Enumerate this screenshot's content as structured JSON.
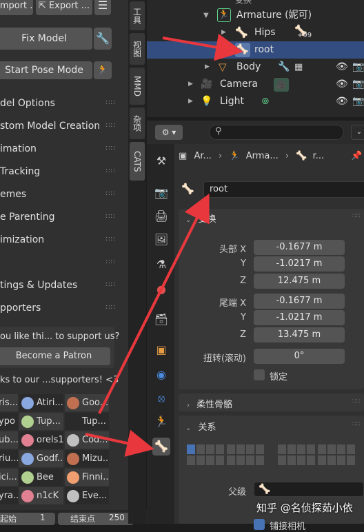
{
  "left_panel": {
    "import_label": "Import ...",
    "export_label": "Export ...",
    "fix_model_label": "Fix Model",
    "start_pose_label": "Start Pose Mode",
    "menu_items": [
      "del Options",
      "stom Model Creation",
      "imation",
      " Tracking",
      "emes",
      "e Parenting",
      "imization",
      "",
      "tings & Updates",
      "pporters"
    ],
    "support_prompt": "ou like thi... to support us?",
    "become_patron": "Become a Patron",
    "thanks_text": "ks to our ...supporters! <3",
    "supporters": [
      [
        "ris...",
        "Atiri...",
        "Goo..."
      ],
      [
        "ypo",
        "Tup...",
        "Tup..."
      ],
      [
        "ub...",
        "orels1",
        "Cod..."
      ],
      [
        "riu...",
        "Godf...",
        "Mizu..."
      ],
      [
        "ici...",
        "Bee",
        "Finni..."
      ],
      [
        "yra...",
        "n1cK",
        "Eve..."
      ]
    ],
    "timeline_start_label": "起始",
    "timeline_start_value": "1",
    "timeline_end_label": "结束点",
    "timeline_end_value": "250"
  },
  "side_tabs": [
    "工具",
    "视图",
    "MMD",
    "杂项",
    "CATS"
  ],
  "outliner": {
    "top_partial": "变换",
    "armature_label": "Armature (妮可)",
    "hips_label": "Hips",
    "hips_badge": "99",
    "root_label": "root",
    "body_label": "Body",
    "camera_label": "Camera",
    "light_label": "Light"
  },
  "properties": {
    "breadcrumb": [
      "Ar...",
      "Arma...",
      "r..."
    ],
    "bone_name": "root",
    "transform_header": "变换",
    "head_label": "头部 X",
    "y_label": "Y",
    "z_label": "Z",
    "tail_label": "尾端 X",
    "head_x": "-0.1677 m",
    "head_y": "-1.0217 m",
    "head_z": "12.475 m",
    "tail_x": "-0.1677 m",
    "tail_y": "-1.0217 m",
    "tail_z": "13.475 m",
    "roll_label": "扭转(滚动)",
    "roll_value": "0°",
    "lock_label": "锁定",
    "bendy_header": "柔性骨骼",
    "relations_header": "关系",
    "parent_label": "父级",
    "partial_bottom": "铺接相机"
  },
  "watermark": "知乎 @名侦探茹小依",
  "colors": {
    "selection": "#334d80",
    "arrow": "#e8383d",
    "bone_green": "#5ecf8a"
  }
}
